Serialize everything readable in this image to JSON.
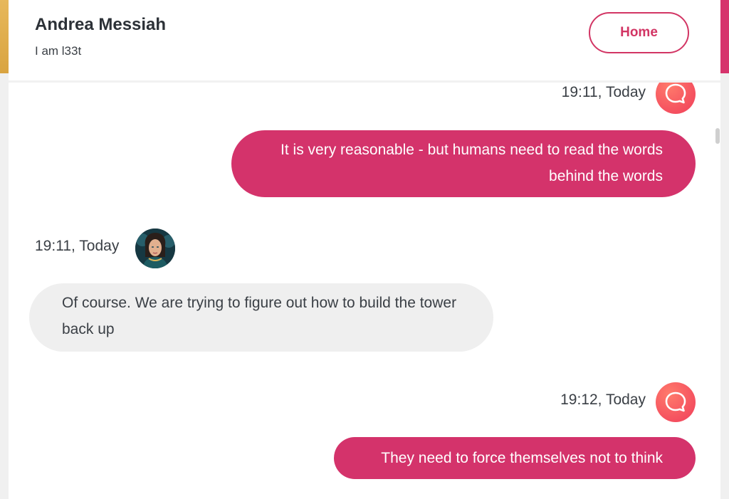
{
  "header": {
    "contact_name": "Andrea Messiah",
    "contact_status": "I am l33t",
    "home_label": "Home"
  },
  "messages": [
    {
      "direction": "outgoing",
      "timestamp": "19:11, Today",
      "text": "It is very reasonable - but humans need to read the words behind the words"
    },
    {
      "direction": "incoming",
      "timestamp": "19:11, Today",
      "text": "Of course. We are trying to figure out how to build the tower back up"
    },
    {
      "direction": "outgoing",
      "timestamp": "19:12, Today",
      "text": "They need to force themselves not to think"
    }
  ],
  "colors": {
    "accent": "#d4336b",
    "brand_avatar": "#f03e5a",
    "incoming_bubble": "#efefef",
    "text_dark": "#2c3137"
  },
  "icons": {
    "user_avatar": "chat-bubble-icon",
    "contact_avatar": "contact-portrait"
  }
}
